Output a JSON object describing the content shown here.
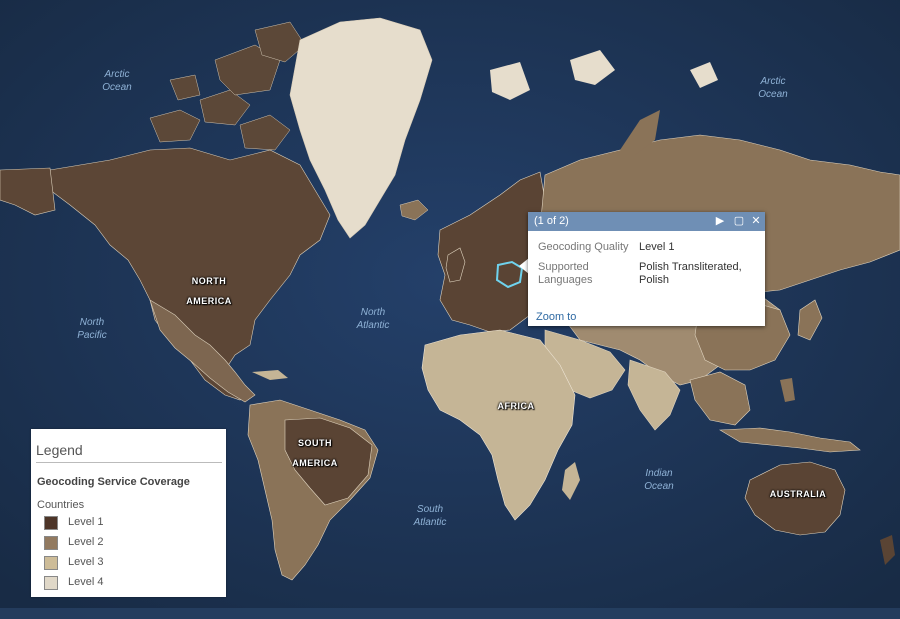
{
  "ocean_labels": {
    "arctic_left": [
      "Arctic",
      "Ocean"
    ],
    "arctic_right": [
      "Arctic",
      "Ocean"
    ],
    "north_pacific": [
      "North",
      "Pacific"
    ],
    "north_atlantic": [
      "North",
      "Atlantic"
    ],
    "south_atlantic": [
      "South",
      "Atlantic"
    ],
    "indian": [
      "Indian",
      "Ocean"
    ]
  },
  "continent_labels": {
    "north_america": [
      "NORTH",
      "AMERICA"
    ],
    "south_america": [
      "SOUTH",
      "AMERICA"
    ],
    "africa": "AFRICA",
    "australia": "AUSTRALIA"
  },
  "popup": {
    "counter": "(1 of 2)",
    "rows": [
      {
        "label": "Geocoding Quality",
        "value": "Level 1"
      },
      {
        "label": "Supported Languages",
        "value": "Polish Transliterated, Polish"
      }
    ],
    "zoom_link": "Zoom to",
    "highlight_color": "#6fd3ee"
  },
  "legend": {
    "title": "Legend",
    "layer": "Geocoding Service Coverage",
    "group": "Countries",
    "items": [
      {
        "label": "Level 1",
        "color": "#4d3528"
      },
      {
        "label": "Level 2",
        "color": "#927a60"
      },
      {
        "label": "Level 3",
        "color": "#cdbc98"
      },
      {
        "label": "Level 4",
        "color": "#e0d8c8"
      }
    ]
  },
  "colors": {
    "ocean": "#1c3350",
    "level1": "#5a4434",
    "level2": "#8a7358",
    "level3": "#c5b596",
    "level4": "#e8dfcf"
  }
}
